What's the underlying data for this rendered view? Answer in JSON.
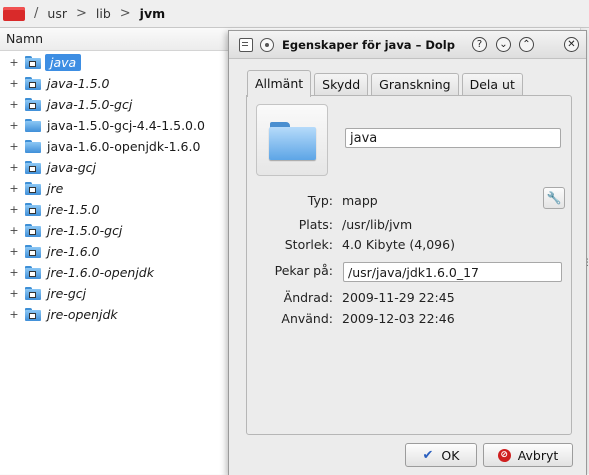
{
  "breadcrumb": {
    "items": [
      "/",
      "usr",
      "lib",
      "jvm"
    ],
    "separator": ">"
  },
  "tree": {
    "header": "Namn",
    "items": [
      {
        "label": "java",
        "italic": true,
        "link": true,
        "selected": true
      },
      {
        "label": "java-1.5.0",
        "italic": true,
        "link": true
      },
      {
        "label": "java-1.5.0-gcj",
        "italic": true,
        "link": true
      },
      {
        "label": "java-1.5.0-gcj-4.4-1.5.0.0",
        "italic": false,
        "link": false
      },
      {
        "label": "java-1.6.0-openjdk-1.6.0",
        "italic": false,
        "link": false
      },
      {
        "label": "java-gcj",
        "italic": true,
        "link": true
      },
      {
        "label": "jre",
        "italic": true,
        "link": true
      },
      {
        "label": "jre-1.5.0",
        "italic": true,
        "link": true
      },
      {
        "label": "jre-1.5.0-gcj",
        "italic": true,
        "link": true
      },
      {
        "label": "jre-1.6.0",
        "italic": true,
        "link": true
      },
      {
        "label": "jre-1.6.0-openjdk",
        "italic": true,
        "link": true
      },
      {
        "label": "jre-gcj",
        "italic": true,
        "link": true
      },
      {
        "label": "jre-openjdk",
        "italic": true,
        "link": true
      }
    ]
  },
  "dialog": {
    "title": "Egenskaper för java – Dolp",
    "help_glyph": "?",
    "minimize_glyph": "⌄",
    "maximize_glyph": "⌃",
    "close_glyph": "✕",
    "tabs": [
      "Allmänt",
      "Skydd",
      "Granskning",
      "Dela ut"
    ],
    "active_tab": "Allmänt",
    "name_value": "java",
    "properties": {
      "type_label": "Typ:",
      "type_value": "mapp",
      "location_label": "Plats:",
      "location_value": "/usr/lib/jvm",
      "size_label": "Storlek:",
      "size_value": "4.0 Kibyte (4,096)",
      "points_to_label": "Pekar på:",
      "points_to_value": "/usr/java/jdk1.6.0_17",
      "modified_label": "Ändrad:",
      "modified_value": "2009-11-29 22:45",
      "accessed_label": "Använd:",
      "accessed_value": "2009-12-03 22:46"
    },
    "ok_label": "OK",
    "cancel_label": "Avbryt"
  },
  "colors": {
    "selection": "#3d8ee3",
    "folder_blue": "#5da5e6",
    "breadcrumb_folder": "#d92a2a",
    "cancel_red": "#cf2020"
  }
}
